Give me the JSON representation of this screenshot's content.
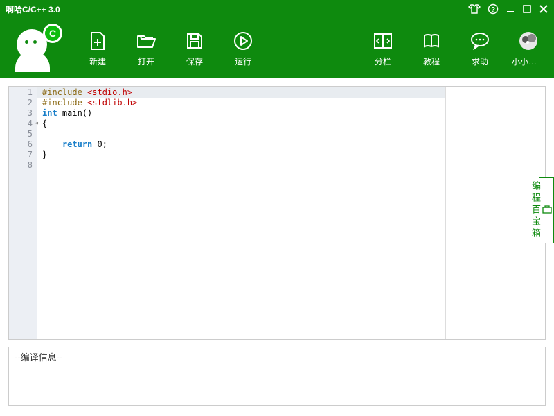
{
  "window": {
    "title": "啊哈C/C++ 3.0"
  },
  "avatar": {
    "bubble": "C"
  },
  "toolbar": {
    "new": "新建",
    "open": "打开",
    "save": "保存",
    "run": "运行",
    "split": "分栏",
    "tutorial": "教程",
    "help": "求助",
    "user": "小小开心..."
  },
  "editor": {
    "lines": [
      {
        "n": 1,
        "html": "<span class='kw-pre'>#include</span> <span class='kw-inc'>&lt;stdio.h&gt;</span>",
        "hl": true
      },
      {
        "n": 2,
        "html": "<span class='kw-pre'>#include</span> <span class='kw-inc'>&lt;stdlib.h&gt;</span>"
      },
      {
        "n": 3,
        "html": "<span class='kw-type'>int</span> main()"
      },
      {
        "n": 4,
        "html": "{",
        "marker": true
      },
      {
        "n": 5,
        "html": " "
      },
      {
        "n": 6,
        "html": "    <span class='kw-type'>return</span> 0;"
      },
      {
        "n": 7,
        "html": "}"
      },
      {
        "n": 8,
        "html": " "
      }
    ]
  },
  "compile": {
    "header": "--编译信息--"
  },
  "side_tab": {
    "label": "编程百宝箱"
  }
}
